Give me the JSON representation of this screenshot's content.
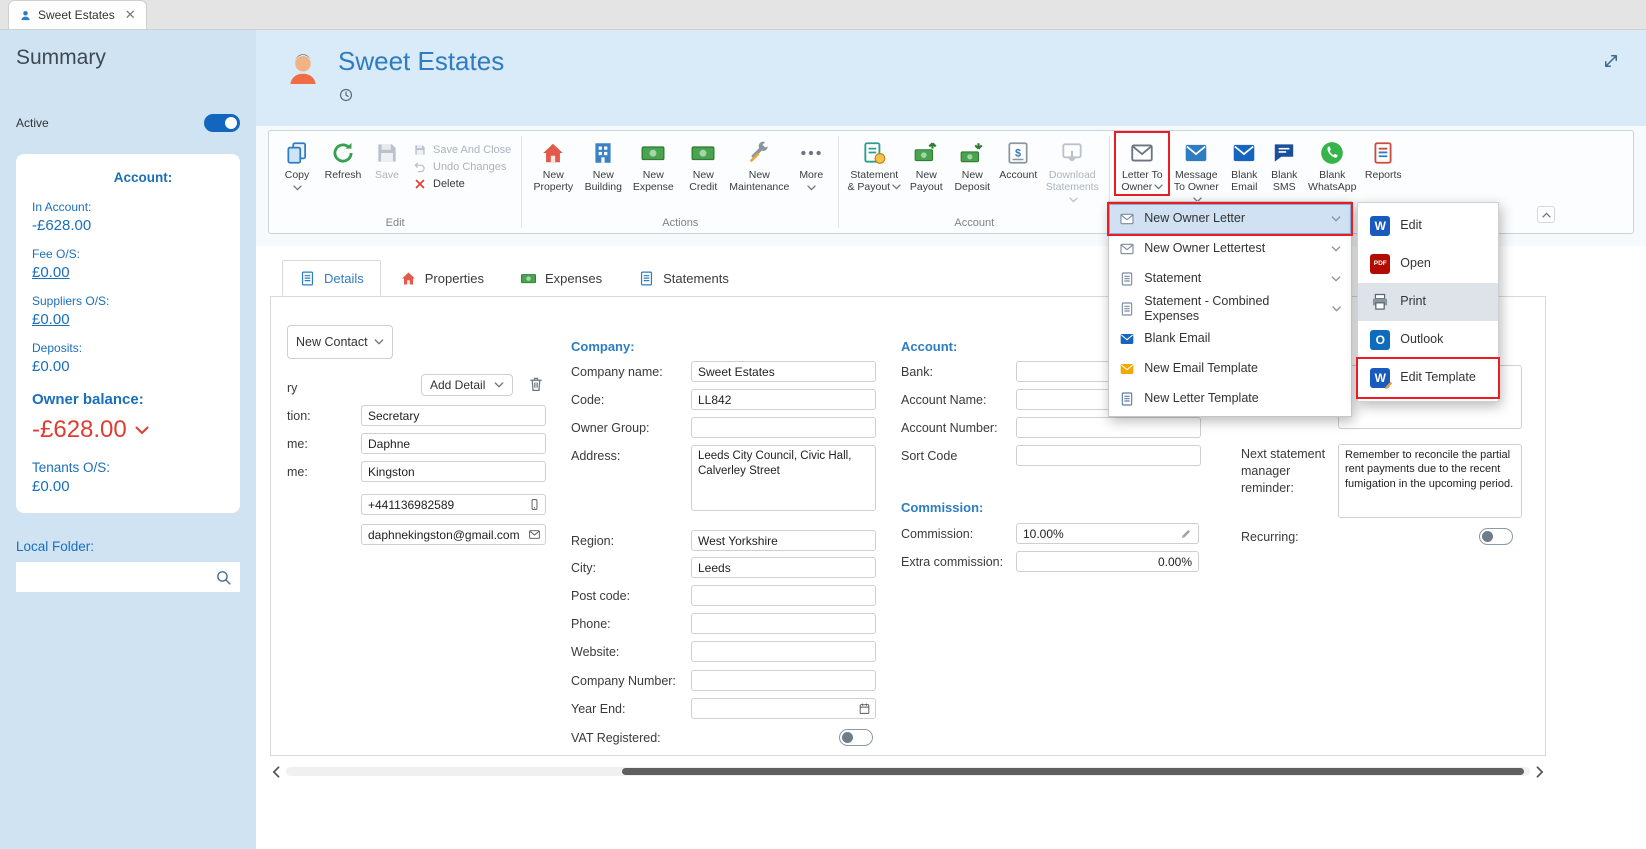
{
  "tabbar": {
    "tab_label": "Sweet Estates"
  },
  "sidebar": {
    "title": "Summary",
    "active_label": "Active",
    "account_card": {
      "heading": "Account:",
      "in_account_label": "In Account:",
      "in_account_value": "-£628.00",
      "fee_label": "Fee O/S:",
      "fee_value": "£0.00",
      "suppliers_label": "Suppliers O/S:",
      "suppliers_value": "£0.00",
      "deposits_label": "Deposits:",
      "deposits_value": "£0.00",
      "owner_balance_label": "Owner balance:",
      "owner_balance_value": "-£628.00",
      "tenants_label": "Tenants O/S:",
      "tenants_value": "£0.00"
    },
    "local_folder_label": "Local Folder:"
  },
  "header": {
    "title": "Sweet Estates"
  },
  "ribbon": {
    "edit": {
      "label": "Edit",
      "copy": "Copy",
      "refresh": "Refresh",
      "save": "Save",
      "save_and_close": "Save And Close",
      "undo_changes": "Undo Changes",
      "delete": "Delete"
    },
    "actions": {
      "label": "Actions",
      "new_property": "New Property",
      "new_building": "New Building",
      "new_expense": "New Expense",
      "new_credit": "New Credit",
      "new_maintenance": "New Maintenance",
      "more": "More"
    },
    "account": {
      "label": "Account",
      "statement_payout": "Statement & Payout",
      "new_payout": "New Payout",
      "new_deposit": "New Deposit",
      "account": "Account",
      "download_statements": "Download Statements"
    },
    "comms": {
      "letter_to_owner": "Letter To Owner",
      "message_to_owner": "Message To Owner",
      "blank_email": "Blank Email",
      "blank_sms": "Blank SMS",
      "blank_whatsapp": "Blank WhatsApp",
      "reports": "Reports"
    }
  },
  "owner_letter_menu": {
    "items": [
      {
        "label": "New Owner Letter"
      },
      {
        "label": "New Owner Lettertest"
      },
      {
        "label": "Statement"
      },
      {
        "label": "Statement - Combined Expenses"
      },
      {
        "label": "Blank Email"
      },
      {
        "label": "New Email Template"
      },
      {
        "label": "New Letter Template"
      }
    ]
  },
  "template_submenu": {
    "items": [
      {
        "label": "Edit"
      },
      {
        "label": "Open"
      },
      {
        "label": "Print"
      },
      {
        "label": "Outlook"
      },
      {
        "label": "Edit Template"
      }
    ]
  },
  "submenu_icon_text": {
    "word": "W",
    "pdf": "PDF",
    "outlook": "O"
  },
  "tabs": {
    "details": "Details",
    "properties": "Properties",
    "expenses": "Expenses",
    "statements": "Statements"
  },
  "form": {
    "contact_type_value": "New Contact",
    "contact": {
      "cut_label_1": "ry",
      "cut_label_2": "tion:",
      "cut_label_3": "me:",
      "cut_label_4": "me:",
      "add_detail_label": "Add Detail",
      "position_value": "Secretary",
      "first_name_value": "Daphne",
      "last_name_value": "Kingston",
      "phone_value": "+441136982589",
      "email_value": "daphnekingston@gmail.com"
    },
    "company": {
      "heading": "Company:",
      "company_name_label": "Company name:",
      "company_name_value": "Sweet Estates",
      "code_label": "Code:",
      "code_value": "LL842",
      "owner_group_label": "Owner Group:",
      "address_label": "Address:",
      "address_value": "Leeds City Council, Civic Hall, Calverley Street",
      "region_label": "Region:",
      "region_value": "West Yorkshire",
      "city_label": "City:",
      "city_value": "Leeds",
      "post_code_label": "Post code:",
      "phone_label": "Phone:",
      "website_label": "Website:",
      "company_number_label": "Company Number:",
      "year_end_label": "Year End:",
      "vat_label": "VAT Registered:"
    },
    "account": {
      "heading": "Account:",
      "bank_label": "Bank:",
      "account_name_label": "Account Name:",
      "account_number_label": "Account Number:",
      "sort_code_label": "Sort Code"
    },
    "commission": {
      "heading": "Commission:",
      "commission_label": "Commission:",
      "commission_value": "10.00%",
      "extra_label": "Extra commission:",
      "extra_value": "0.00%"
    },
    "reminder": {
      "label": "Next statement manager reminder:",
      "value": "Remember to reconcile the partial rent payments due to the recent fumigation in the upcoming period."
    },
    "recurring_label": "Recurring:"
  }
}
